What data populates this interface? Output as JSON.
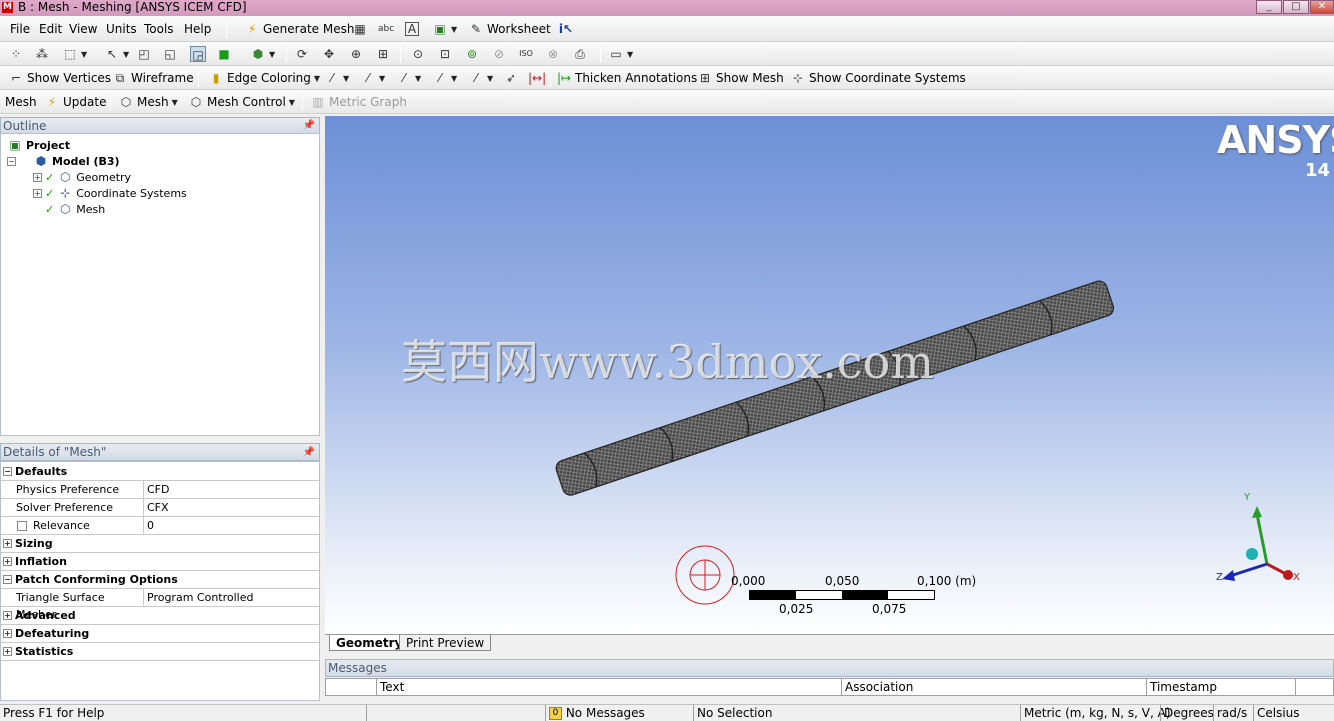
{
  "window": {
    "title": "B : Mesh - Meshing [ANSYS ICEM CFD]",
    "app_logo": "M",
    "controls": [
      "_",
      "□",
      "✕"
    ]
  },
  "menubar": {
    "items": [
      "File",
      "Edit",
      "View",
      "Units",
      "Tools",
      "Help"
    ],
    "generate_mesh": "Generate Mesh",
    "worksheet": "Worksheet"
  },
  "toolbar3": {
    "show_vertices": "Show Vertices",
    "wireframe": "Wireframe",
    "edge_coloring": "Edge Coloring",
    "thicken_annotations": "Thicken Annotations",
    "show_mesh": "Show Mesh",
    "show_coordinate_systems": "Show Coordinate Systems"
  },
  "toolbar4": {
    "mesh": "Mesh",
    "update": "Update",
    "mesh_dropdown": "Mesh",
    "mesh_control": "Mesh Control",
    "metric_graph": "Metric Graph"
  },
  "outline": {
    "header": "Outline",
    "project": "Project",
    "model": "Model (B3)",
    "children": [
      "Geometry",
      "Coordinate Systems",
      "Mesh"
    ]
  },
  "details": {
    "header": "Details of \"Mesh\"",
    "rows": [
      {
        "type": "group",
        "label": "Defaults",
        "expanded": true
      },
      {
        "type": "prop",
        "label": "Physics Preference",
        "value": "CFD"
      },
      {
        "type": "prop",
        "label": "Solver Preference",
        "value": "CFX"
      },
      {
        "type": "prop",
        "label": "Relevance",
        "value": "0",
        "checkbox": true
      },
      {
        "type": "group",
        "label": "Sizing",
        "expanded": false
      },
      {
        "type": "group",
        "label": "Inflation",
        "expanded": false
      },
      {
        "type": "group",
        "label": "Patch Conforming Options",
        "expanded": true
      },
      {
        "type": "prop",
        "label": "Triangle Surface Mesher",
        "value": "Program Controlled"
      },
      {
        "type": "group",
        "label": "Advanced",
        "expanded": false
      },
      {
        "type": "group",
        "label": "Defeaturing",
        "expanded": false
      },
      {
        "type": "group",
        "label": "Statistics",
        "expanded": false
      }
    ]
  },
  "viewport": {
    "brand": "ANSYS",
    "version": "14",
    "watermark": "莫西网www.3dmox.com",
    "scale_top": [
      "0,000",
      "0,050",
      "0,100 (m)"
    ],
    "scale_bottom": [
      "0,025",
      "0,075"
    ],
    "axes": {
      "y": "Y",
      "z": "Z",
      "x": "X"
    },
    "colors": {
      "y_axis": "#2a9a2a",
      "z_axis": "#1a2ab0",
      "x_axis": "#c01818",
      "origin": "#20b0b0"
    }
  },
  "tabs": [
    "Geometry",
    "Print Preview"
  ],
  "messages": {
    "header": "Messages",
    "columns": [
      "Text",
      "Association",
      "Timestamp"
    ]
  },
  "statusbar": {
    "help": "Press F1 for Help",
    "messages_count": "0",
    "no_messages": "No Messages",
    "selection": "No Selection",
    "units": "Metric (m, kg, N, s, V, A)",
    "angle": "Degrees",
    "rate": "rad/s",
    "temp": "Celsius"
  }
}
